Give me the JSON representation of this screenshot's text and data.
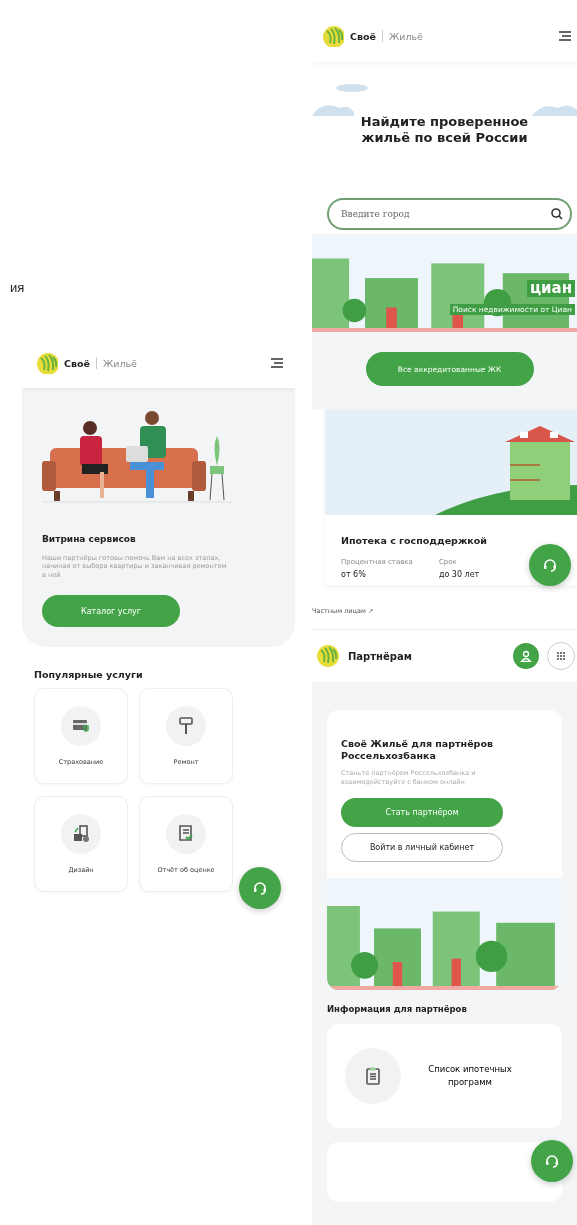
{
  "fragment_text": "ия",
  "services_screen": {
    "logo": {
      "name": "Своё",
      "tagline": "Жильё"
    },
    "hero": {
      "title": "Витрина сервисов",
      "description": "Наши партнёры готовы помочь Вам на всех этапах, начиная от выбора квартиры и заканчивая ремонтом в ней",
      "button": "Каталог услуг"
    },
    "popular": {
      "title": "Популярные услуги",
      "items": [
        {
          "label": "Страхование",
          "kind": "insurance"
        },
        {
          "label": "Ремонт",
          "kind": "repair"
        },
        {
          "label": "Дизайн",
          "kind": "design"
        },
        {
          "label": "Отчёт об оценке",
          "kind": "report"
        }
      ]
    }
  },
  "home_screen": {
    "logo": {
      "name": "Своё",
      "tagline": "Жильё"
    },
    "headline": "Найдите проверенное жильё по всей России",
    "search": {
      "placeholder": "Введите город"
    },
    "banner": {
      "brand": "циан",
      "caption": "Поиск недвижимости от Циан"
    },
    "button": "Все аккредитованные ЖК",
    "mortgage_card": {
      "title": "Ипотека с господдержкой",
      "facts": [
        {
          "label": "Процентная ставка",
          "value": "от 6%"
        },
        {
          "label": "Срок",
          "value": "до 30 лет"
        }
      ]
    },
    "footer_link": "Частным лицам ↗"
  },
  "partners_screen": {
    "title": "Партнёрам",
    "card": {
      "title": "Своё Жильё для партнёров Россельхозбанка",
      "description": "Станьте партнёром Россельхозбанка и взаимодействуйте с банком онлайн",
      "buttons": [
        {
          "label": "Стать партнёром",
          "kind": "primary"
        },
        {
          "label": "Войти в личный кабинет",
          "kind": "outline"
        }
      ]
    },
    "info": {
      "title": "Информация для партнёров",
      "items": [
        {
          "label": "Список ипотечных программ",
          "kind": "list"
        }
      ]
    }
  }
}
